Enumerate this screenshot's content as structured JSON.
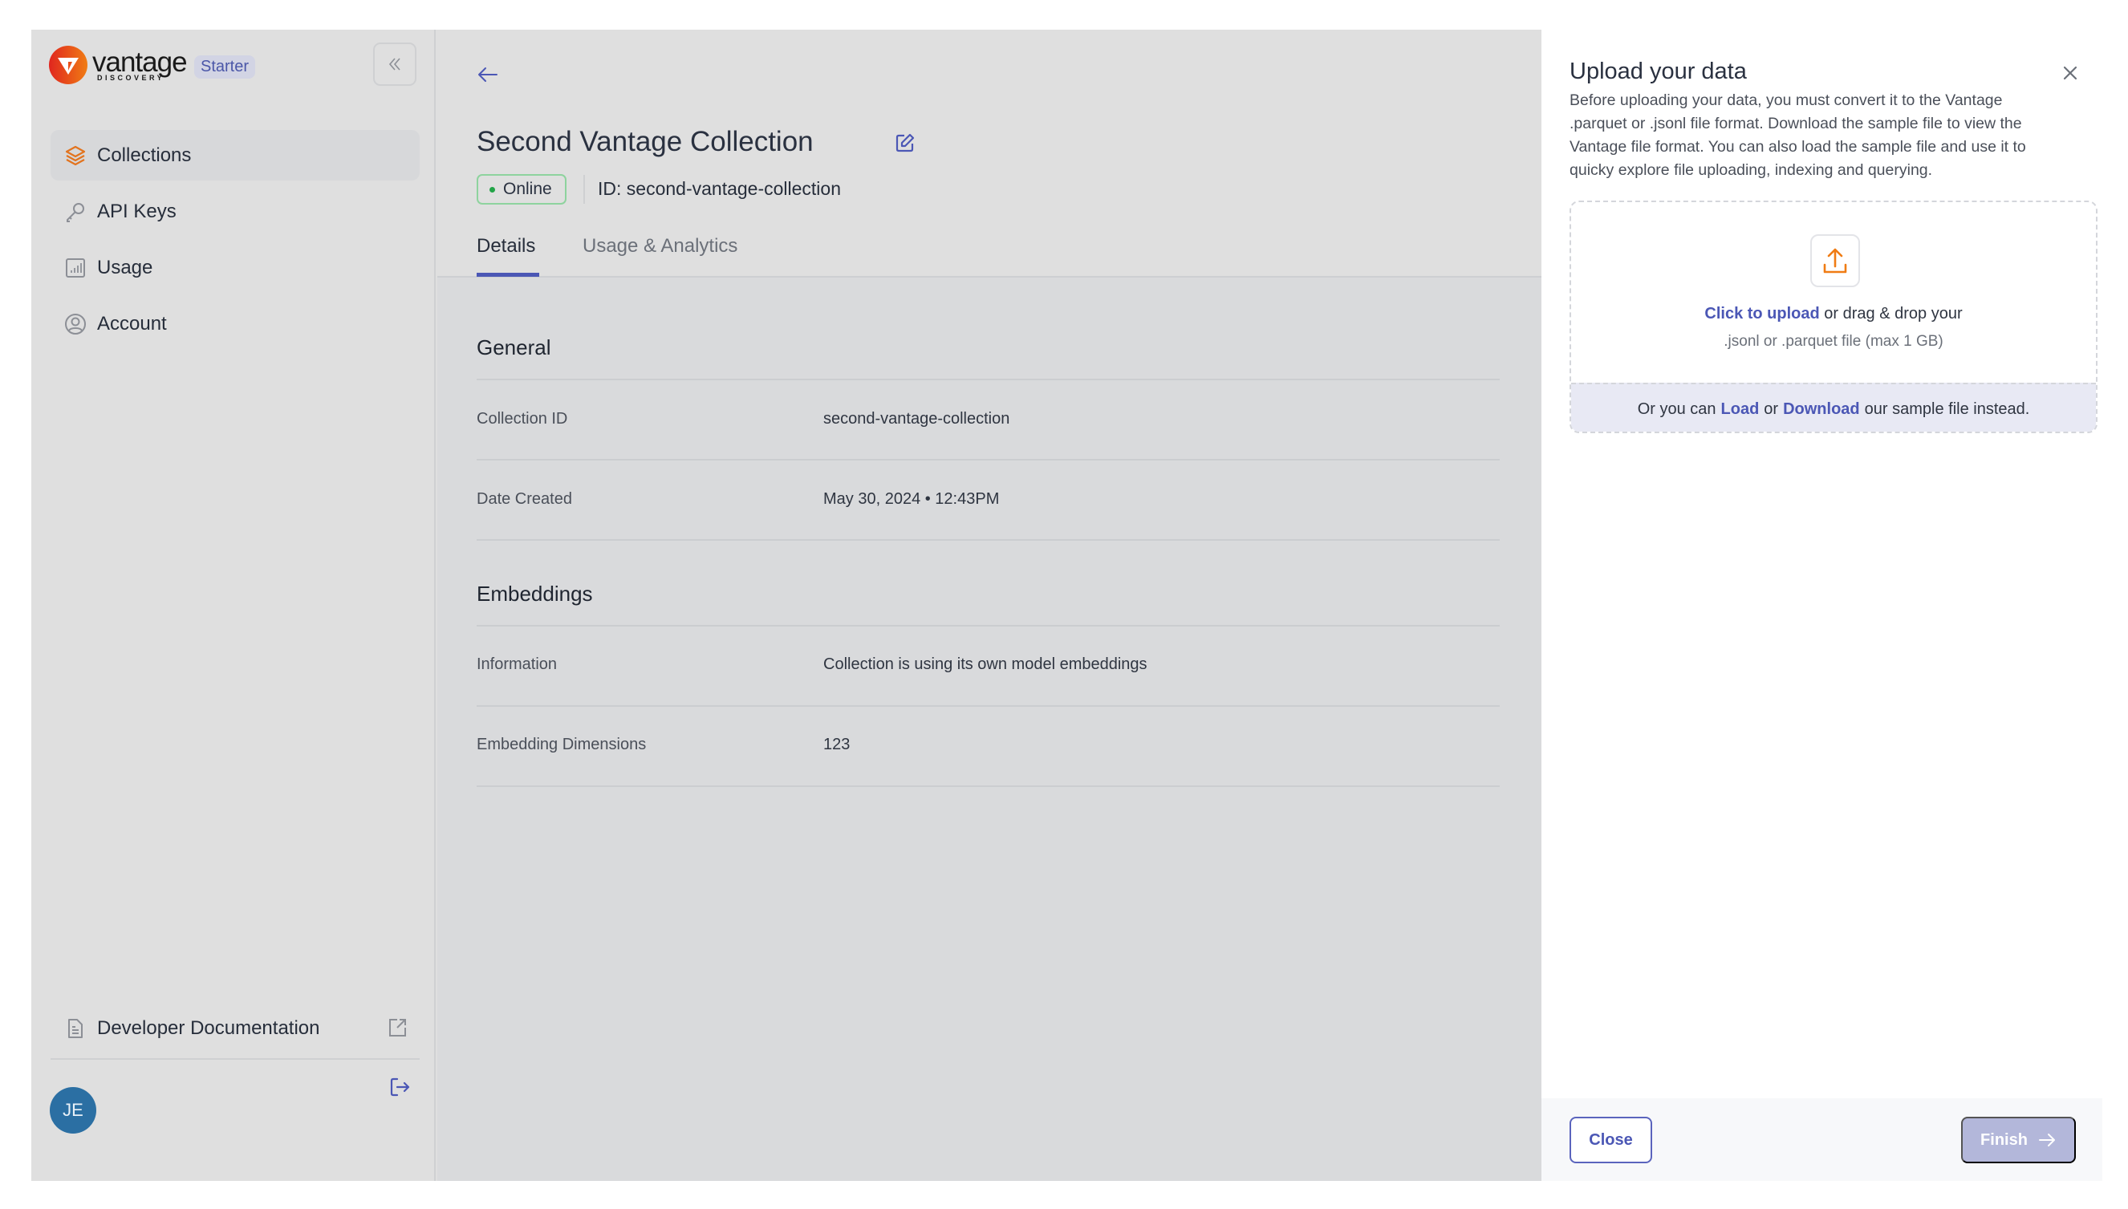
{
  "sidebar": {
    "brand": {
      "name": "vantage",
      "subtitle": "DISCOVERY"
    },
    "plan_badge": "Starter",
    "collapse_icon": "double-chevron-left-icon",
    "items": [
      {
        "label": "Collections",
        "icon": "layers-icon",
        "active": true
      },
      {
        "label": "API Keys",
        "icon": "key-icon",
        "active": false
      },
      {
        "label": "Usage",
        "icon": "bar-chart-icon",
        "active": false
      },
      {
        "label": "Account",
        "icon": "user-circle-icon",
        "active": false
      }
    ],
    "docs_link": {
      "label": "Developer Documentation",
      "icon": "document-icon",
      "external_icon": "external-link-icon"
    },
    "user": {
      "initials": "JE",
      "avatar_color": "#2b6fa3"
    },
    "logout_icon": "logout-icon"
  },
  "main": {
    "back_icon": "arrow-left-icon",
    "title": "Second Vantage Collection",
    "edit_icon": "edit-icon",
    "status": {
      "label": "Online",
      "color": "#22a447"
    },
    "id_text": "ID: second-vantage-collection",
    "tabs": [
      {
        "label": "Details",
        "active": true
      },
      {
        "label": "Usage & Analytics",
        "active": false
      }
    ],
    "sections": [
      {
        "title": "General",
        "rows": [
          {
            "label": "Collection ID",
            "value": "second-vantage-collection"
          },
          {
            "label": "Date Created",
            "value": "May 30, 2024 • 12:43PM"
          }
        ]
      },
      {
        "title": "Embeddings",
        "rows": [
          {
            "label": "Information",
            "value": "Collection is using its own model embeddings"
          },
          {
            "label": "Embedding Dimensions",
            "value": "123"
          }
        ]
      }
    ]
  },
  "drawer": {
    "title": "Upload your data",
    "description": "Before uploading your data, you must convert it to the Vantage .parquet or .jsonl file format. Download the sample file to view the Vantage file format. You can also load the sample file and use it to quicky explore file uploading, indexing and querying.",
    "dropzone": {
      "icon": "upload-icon",
      "link_text": "Click to upload",
      "line1_rest": " or drag & drop your",
      "line2": ".jsonl or .parquet file (max 1 GB)",
      "footer_prefix": "Or you can",
      "load_link": "Load",
      "or_text": "or",
      "download_link": "Download",
      "footer_suffix": "our sample file instead."
    },
    "close_button": "Close",
    "finish_button": "Finish",
    "accent_color": "#4b57b5",
    "upload_icon_color": "#f07c14"
  }
}
